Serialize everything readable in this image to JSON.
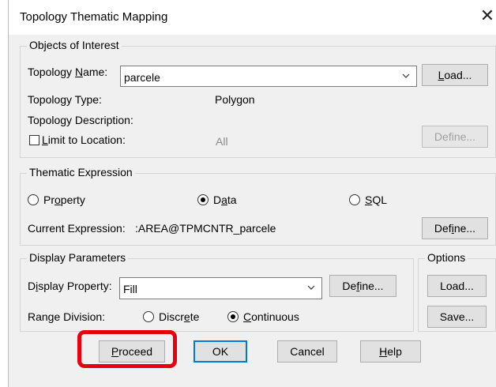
{
  "window": {
    "title": "Topology Thematic Mapping",
    "close_glyph": "✕"
  },
  "objects_of_interest": {
    "legend": "Objects of Interest",
    "topology_name_label_pre": "Topology ",
    "topology_name_label_ul": "N",
    "topology_name_label_post": "ame:",
    "topology_name_value": "parcele",
    "load_pre": "",
    "load_ul": "L",
    "load_post": "oad...",
    "topology_type_label": "Topology Type:",
    "topology_type_value": "Polygon",
    "topology_description_label": "Topology Description:",
    "limit_to_location_ul": "L",
    "limit_to_location_post": "imit to Location:",
    "limit_to_location_checked": false,
    "location_value": "All",
    "define_label": "Define..."
  },
  "thematic_expression": {
    "legend": "Thematic Expression",
    "property_pre": "Pr",
    "property_ul": "o",
    "property_post": "perty",
    "data_pre": "D",
    "data_ul": "a",
    "data_post": "ta",
    "sql_pre": "",
    "sql_ul": "S",
    "sql_post": "QL",
    "selected": "Data",
    "current_expression_label": "Current Expression:",
    "current_expression_value": ":AREA@TPMCNTR_parcele",
    "define_pre": "Def",
    "define_ul": "i",
    "define_post": "ne..."
  },
  "display_parameters": {
    "legend": "Display Parameters",
    "display_property_pre": "D",
    "display_property_ul": "i",
    "display_property_post": "splay Property:",
    "display_property_value": "Fill",
    "define_pre": "De",
    "define_ul": "f",
    "define_post": "ine...",
    "range_division_label": "Range Division:",
    "discrete_pre": "Discr",
    "discrete_ul": "e",
    "discrete_post": "te",
    "continuous_pre": "",
    "continuous_ul": "C",
    "continuous_post": "ontinuous",
    "selected": "Continuous"
  },
  "options": {
    "legend": "Options",
    "load_label": "Load...",
    "save_label": "Save..."
  },
  "footer": {
    "proceed_pre": "",
    "proceed_ul": "P",
    "proceed_post": "roceed",
    "ok_label": "OK",
    "cancel_label": "Cancel",
    "help_pre": "",
    "help_ul": "H",
    "help_post": "elp"
  },
  "colors": {
    "dialog_bg": "#f0f0f0",
    "button_bg": "#e1e1e1",
    "default_button_border": "#0078d7",
    "highlight_annotation": "#e8000e"
  }
}
